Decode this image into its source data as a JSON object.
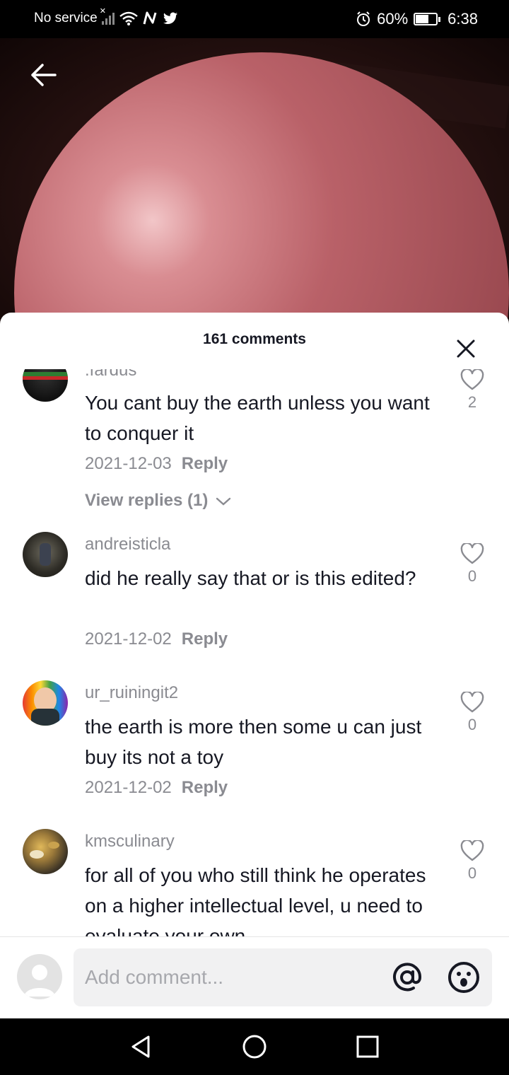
{
  "status_bar": {
    "carrier": "No service",
    "battery": "60%",
    "time": "6:38",
    "icons": [
      "signal-icon",
      "wifi-icon",
      "nfc-icon",
      "twitter-icon",
      "alarm-icon",
      "battery-icon"
    ]
  },
  "comments_panel": {
    "count_title": "161 comments",
    "comments": [
      {
        "username": ".fardus",
        "text": "You cant buy the earth unless you want to conquer it",
        "date": "2021-12-03",
        "reply_label": "Reply",
        "likes": "2",
        "view_replies": "View replies (1)"
      },
      {
        "username": "andreisticla",
        "text": "did he really say that or is this edited?",
        "date": "2021-12-02",
        "reply_label": "Reply",
        "likes": "0"
      },
      {
        "username": "ur_ruiningit2",
        "text": "the earth is more then some u can just buy its not a toy",
        "date": "2021-12-02",
        "reply_label": "Reply",
        "likes": "0"
      },
      {
        "username": "kmsculinary",
        "text": "for all of you who still think he operates on a higher intellectual level, u need to evaluate your own",
        "likes": "0"
      }
    ]
  },
  "composer": {
    "placeholder": "Add comment...",
    "value": ""
  },
  "colors": {
    "text_primary": "#161823",
    "text_secondary": "#8a8b91",
    "input_bg": "#f1f1f2"
  }
}
